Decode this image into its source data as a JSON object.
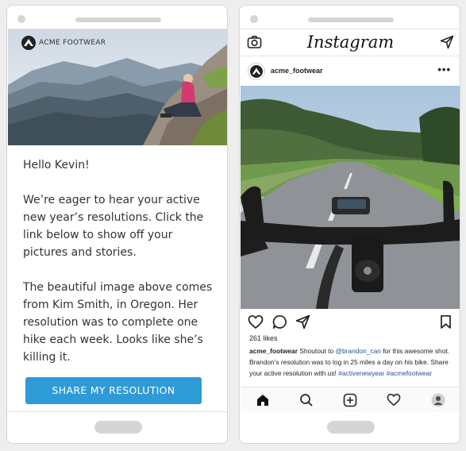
{
  "email": {
    "brand_name": "ACME FOOTWEAR",
    "greeting": "Hello Kevin!",
    "paragraph_1": "We’re eager to hear your active new year’s resolutions. Click the link below to show off your pictures and stories.",
    "paragraph_2": "The beautiful image above comes from Kim Smith, in Oregon. Her resolution was to complete one hike each week. Looks like she’s killing it.",
    "cta_label": "SHARE MY RESOLUTION",
    "cta_color": "#2e9bd6"
  },
  "instagram": {
    "app_title": "Instagram",
    "username": "acme_footwear",
    "more_label": "•••",
    "likes": "261 likes",
    "caption": {
      "username": "acme_footwear",
      "text_1": " Shoutout to ",
      "mention": "@brandon_can",
      "text_2": " for this awesome shot. Brandon’s resolution was to log in 25 miles a day on his bike. Share your active resolution with us! ",
      "hashtag_1": "#activenewyear",
      "text_3": " ",
      "hashtag_2": "#acmefootwear"
    },
    "header_icons": [
      "camera-icon",
      "send-icon"
    ],
    "action_icons": [
      "heart-icon",
      "comment-icon",
      "share-icon",
      "bookmark-icon"
    ],
    "tab_icons": [
      "home-icon",
      "search-icon",
      "add-post-icon",
      "activity-heart-icon",
      "profile-avatar"
    ],
    "link_color": "#2a4f93"
  }
}
